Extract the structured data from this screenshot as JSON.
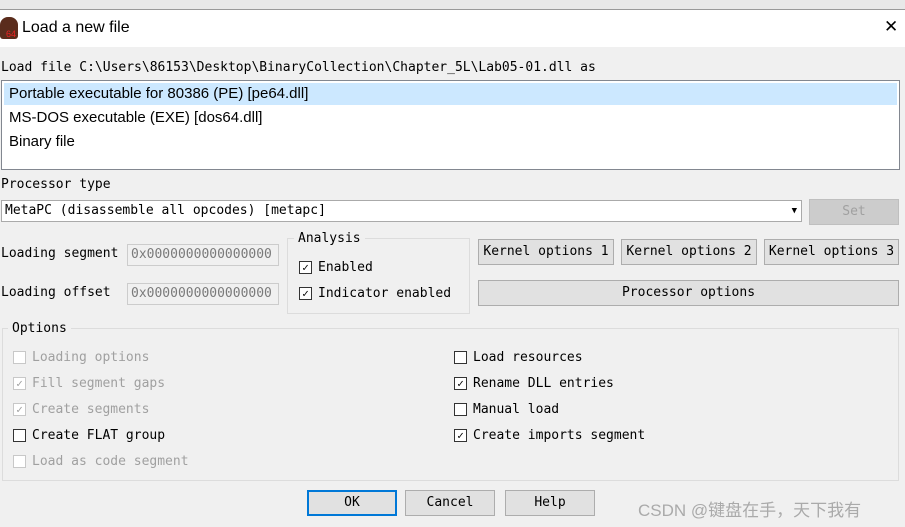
{
  "window": {
    "title": "Load a new file",
    "close": "✕",
    "icon_text": "64"
  },
  "load_file_label": "Load file C:\\Users\\86153\\Desktop\\BinaryCollection\\Chapter_5L\\Lab05-01.dll as",
  "file_types": [
    {
      "label": "Portable executable for 80386 (PE) [pe64.dll]",
      "selected": true
    },
    {
      "label": "MS-DOS executable (EXE) [dos64.dll]",
      "selected": false
    },
    {
      "label": "Binary file",
      "selected": false
    }
  ],
  "processor": {
    "label": "Processor type",
    "value": "MetaPC (disassemble all opcodes) [metapc]",
    "set": "Set"
  },
  "loading_segment": {
    "label": "Loading segment",
    "value": "0x0000000000000000"
  },
  "loading_offset": {
    "label": "Loading offset",
    "value": "0x0000000000000000"
  },
  "analysis": {
    "title": "Analysis",
    "enabled": "Enabled",
    "indicator": "Indicator enabled"
  },
  "buttons": {
    "k1": "Kernel options 1",
    "k2": "Kernel options 2",
    "k3": "Kernel options 3",
    "proc_opts": "Processor options",
    "ok": "OK",
    "cancel": "Cancel",
    "help": "Help"
  },
  "options": {
    "title": "Options",
    "left": [
      {
        "label": "Loading options",
        "checked": false,
        "disabled": true
      },
      {
        "label": "Fill segment gaps",
        "checked": true,
        "disabled": true
      },
      {
        "label": "Create segments",
        "checked": true,
        "disabled": true
      },
      {
        "label": "Create FLAT group",
        "checked": false,
        "disabled": false
      },
      {
        "label": "Load as code segment",
        "checked": false,
        "disabled": true
      }
    ],
    "right": [
      {
        "label": "Load resources",
        "checked": false
      },
      {
        "label": "Rename DLL entries",
        "checked": true
      },
      {
        "label": "Manual load",
        "checked": false
      },
      {
        "label": "Create imports segment",
        "checked": true
      }
    ]
  },
  "watermark": "CSDN @键盘在手，天下我有"
}
